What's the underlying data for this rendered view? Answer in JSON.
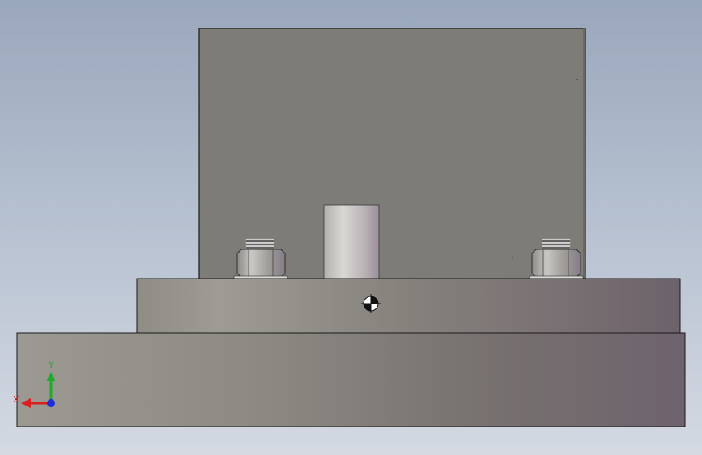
{
  "viewport": {
    "background_top": "#9aa7bb",
    "background_bottom": "#d4d9e2"
  },
  "model": {
    "plate_color": "#7e7c76",
    "edge_color": "#1a1a1a"
  },
  "triad": {
    "x_label": "X",
    "y_label": "Y",
    "x_color": "#d81e1e",
    "y_color": "#1faa2a",
    "z_color": "#1d2fd8"
  },
  "icons": {
    "center_of_mass": "center-of-mass-icon"
  }
}
